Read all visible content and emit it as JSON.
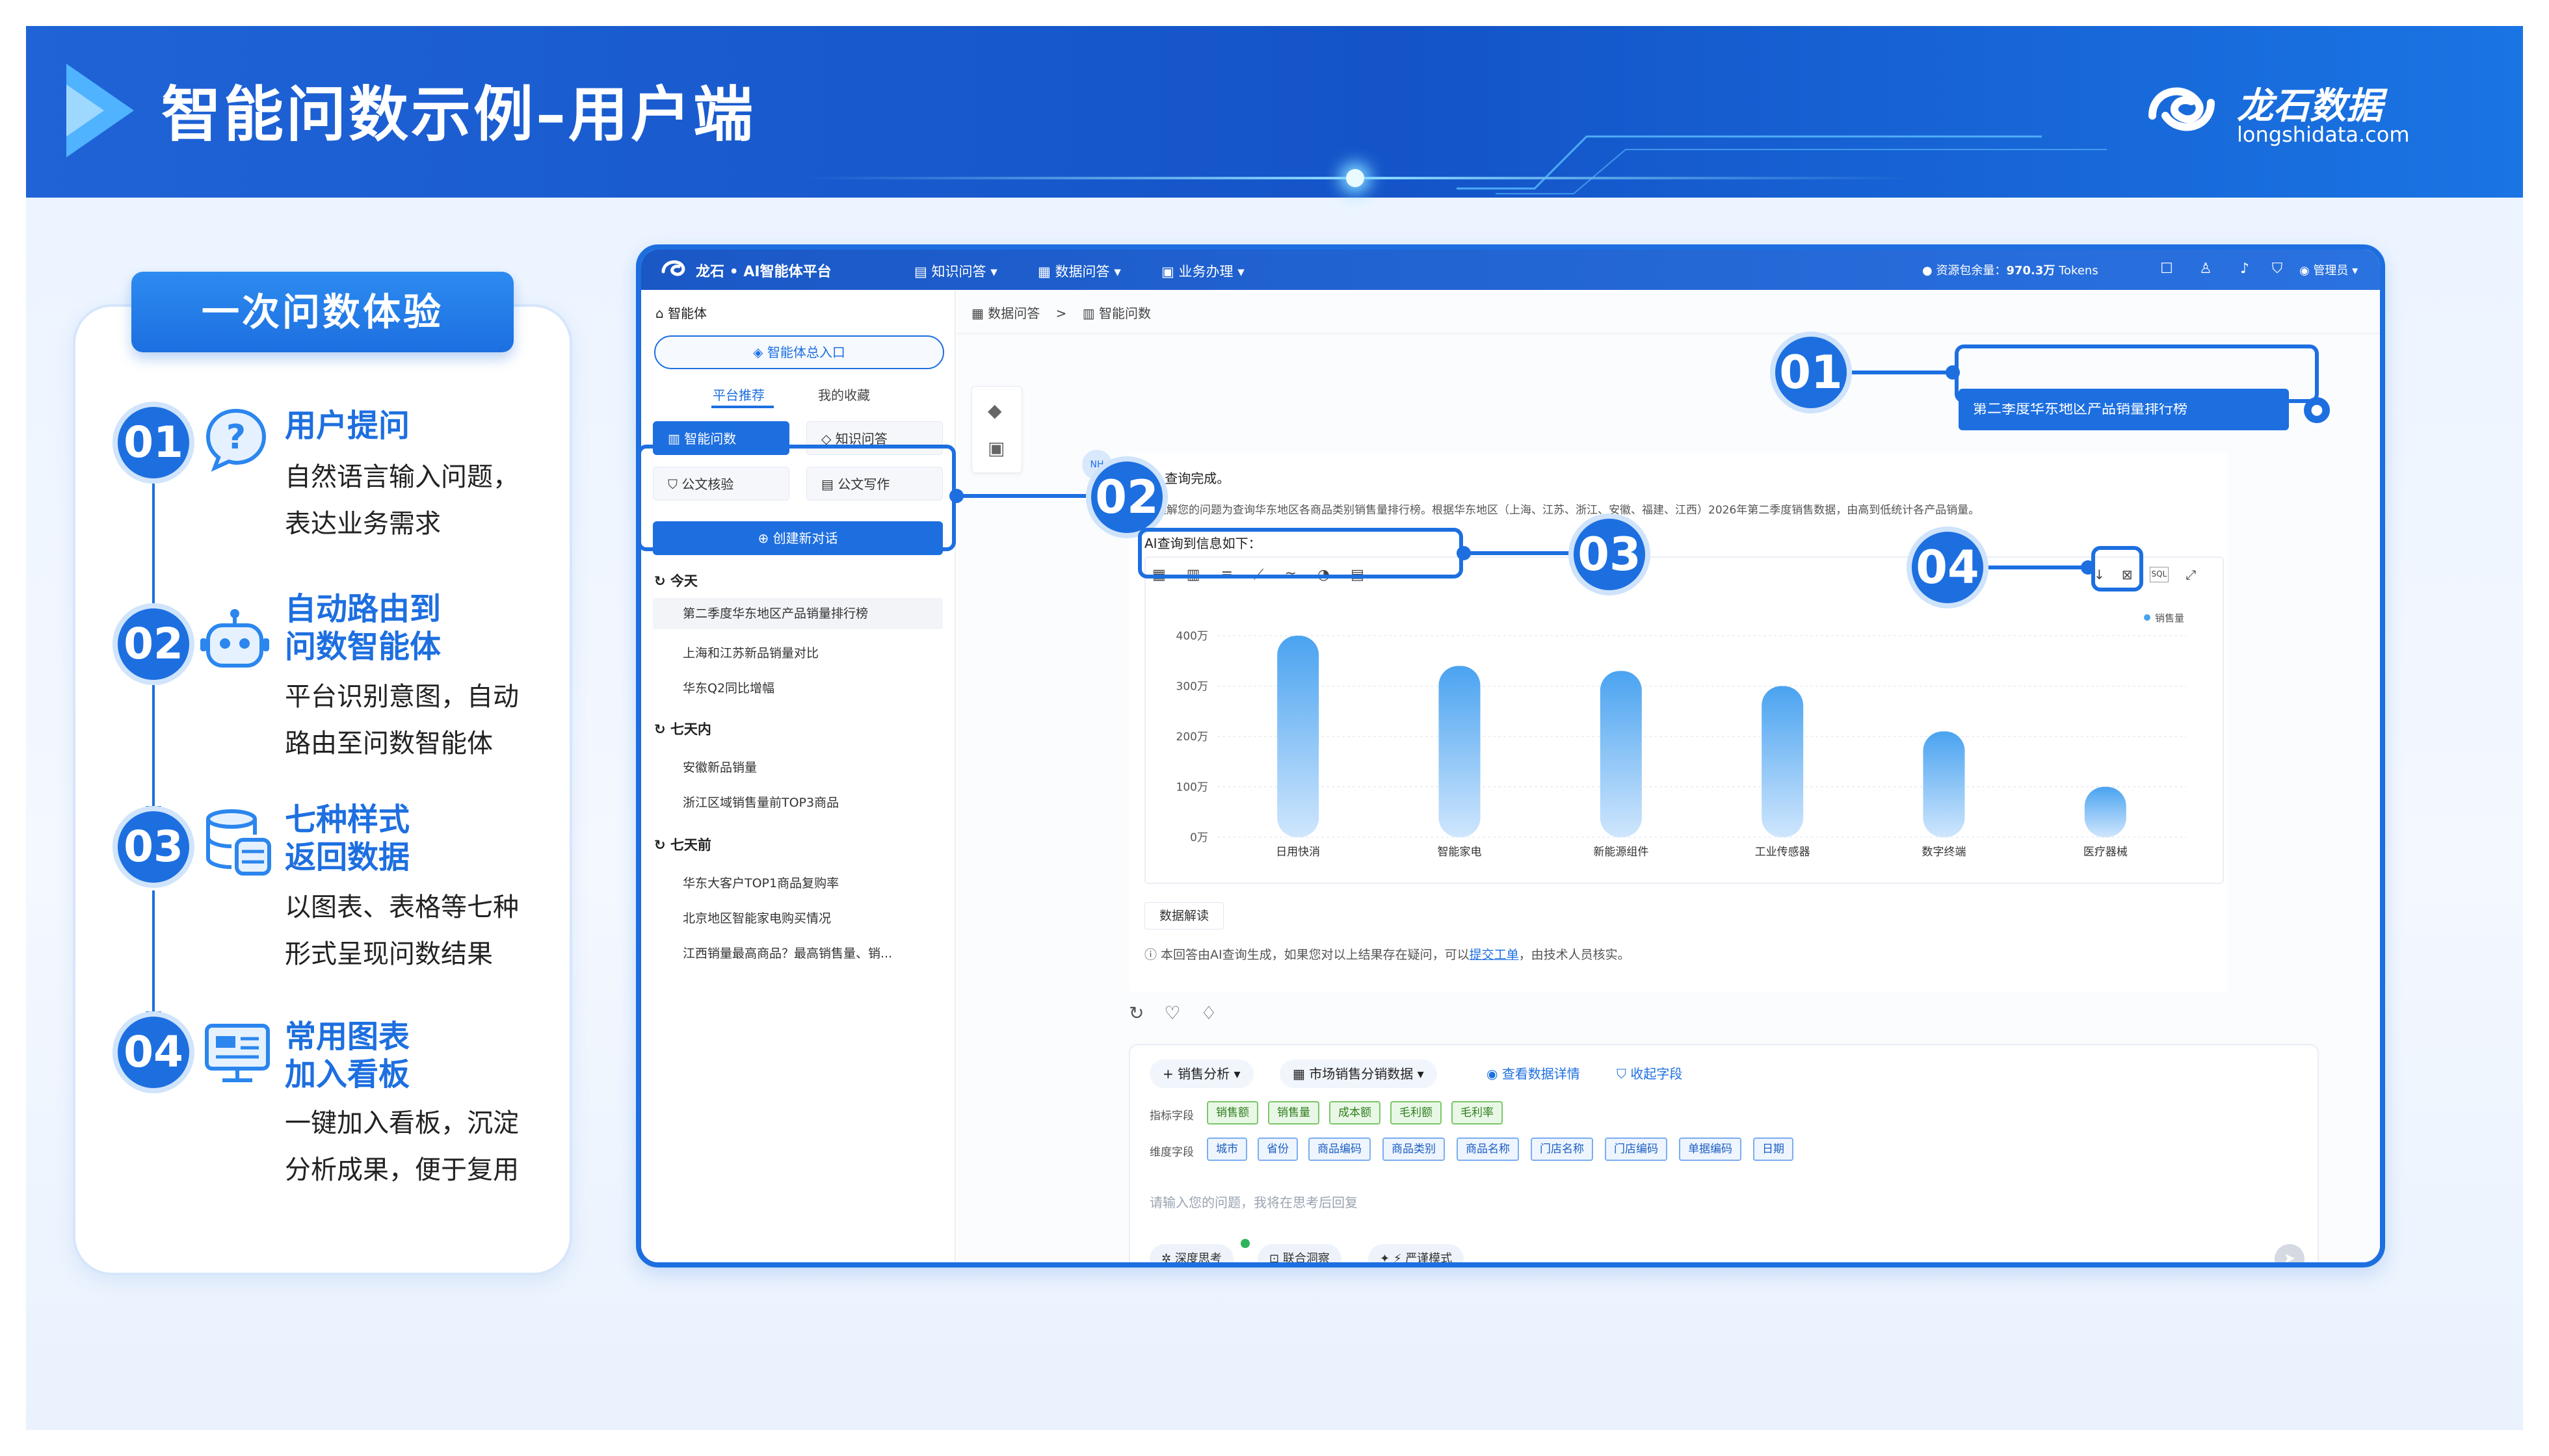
{
  "header": {
    "title": "智能问数示例–用户端",
    "brand": "龙石数据",
    "domain": "longshidata.com"
  },
  "left_panel": {
    "title": "一次问数体验",
    "steps": [
      {
        "num": "01",
        "heading_lines": [
          "用户提问"
        ],
        "desc_lines": [
          "自然语言输入问题，",
          "表达业务需求"
        ],
        "icon": "question-bubble-icon"
      },
      {
        "num": "02",
        "heading_lines": [
          "自动路由到",
          "问数智能体"
        ],
        "desc_lines": [
          "平台识别意图，自动",
          "路由至问数智能体"
        ],
        "icon": "robot-icon"
      },
      {
        "num": "03",
        "heading_lines": [
          "七种样式",
          "返回数据"
        ],
        "desc_lines": [
          "以图表、表格等七种",
          "形式呈现问数结果"
        ],
        "icon": "database-icon"
      },
      {
        "num": "04",
        "heading_lines": [
          "常用图表",
          "加入看板"
        ],
        "desc_lines": [
          "一键加入看板，沉淀",
          "分析成果，便于复用"
        ],
        "icon": "dashboard-board-icon"
      }
    ]
  },
  "app": {
    "name": "龙石 • AI智能体平台",
    "nav": [
      "知识问答",
      "数据问答",
      "业务办理"
    ],
    "resource_label": "资源包余量：",
    "resource_value": "970.3万",
    "resource_unit": "Tokens",
    "admin": "管理员",
    "sidebar": {
      "agent_label": "智能体",
      "entry": "智能体总入口",
      "tabs": [
        "平台推荐",
        "我的收藏"
      ],
      "tools": [
        "智能问数",
        "知识问答",
        "公文核验",
        "公文写作"
      ],
      "new_chat": "创建新对话",
      "sections": [
        {
          "title": "今天",
          "items": [
            "第二季度华东地区产品销量排行榜",
            "上海和江苏新品销量对比",
            "华东Q2同比增幅"
          ]
        },
        {
          "title": "七天内",
          "items": [
            "安徽新品销量",
            "浙江区域销售量前TOP3商品"
          ]
        },
        {
          "title": "七天前",
          "items": [
            "华东大客户TOP1商品复购率",
            "北京地区智能家电购买情况",
            "江西销量最高商品？最高销售量、销..."
          ]
        }
      ]
    },
    "breadcrumb": [
      "数据问答",
      ">",
      "智能问数"
    ],
    "user_query": "第二季度华东地区产品销量排行榜",
    "answer": {
      "status": "查询完成。",
      "description": "我理解您的问题为查询华东地区各商品类别销售量排行榜。根据华东地区（上海、江苏、浙江、安徽、福建、江西）2026年第二季度销售数据，由高到低统计各产品销量。",
      "info_title": "AI查询到信息如下：",
      "interpret_button": "数据解读",
      "note_prefix": "本回答由AI查询生成，如果您对以上结果存在疑问，可以",
      "note_link": "提交工单",
      "note_suffix": "，由技术人员核实。",
      "chart_tools": [
        "table-icon",
        "bar-chart-icon",
        "horizontal-bar-icon",
        "line-chart-icon",
        "area-chart-icon",
        "pie-chart-icon",
        "indicator-card-icon"
      ],
      "chart_extra_sql": "SQL"
    },
    "composer": {
      "chip_analysis": "销售分析",
      "chip_dataset": "市场销售分销数据",
      "chip_detail": "查看数据详情",
      "chip_collapse": "收起字段",
      "metric_label": "指标字段",
      "metrics": [
        "销售额",
        "销售量",
        "成本额",
        "毛利额",
        "毛利率"
      ],
      "dim_label": "维度字段",
      "dims": [
        "城市",
        "省份",
        "商品编码",
        "商品类别",
        "商品名称",
        "门店名称",
        "门店编码",
        "单据编码",
        "日期"
      ],
      "placeholder": "请输入您的问题，我将在思考后回复",
      "bottom_chips": [
        "深度思考",
        "联合洞察",
        "严谨模式"
      ]
    }
  },
  "callouts": [
    "01",
    "02",
    "03",
    "04"
  ],
  "colors": {
    "primary": "#1d6fe0",
    "header": "#1454c8",
    "bar_top": "#4aa3f0",
    "bar_bottom": "#cfe6fd"
  },
  "chart_data": {
    "type": "bar",
    "categories": [
      "日用快消",
      "智能家电",
      "新能源组件",
      "工业传感器",
      "数字终端",
      "医疗器械"
    ],
    "series": [
      {
        "name": "销售量",
        "values": [
          400,
          340,
          330,
          300,
          210,
          100
        ]
      }
    ],
    "ylim": [
      0,
      400
    ],
    "yticks": [
      "0万",
      "100万",
      "200万",
      "300万",
      "400万"
    ],
    "grid": true,
    "legend": "top-right"
  }
}
